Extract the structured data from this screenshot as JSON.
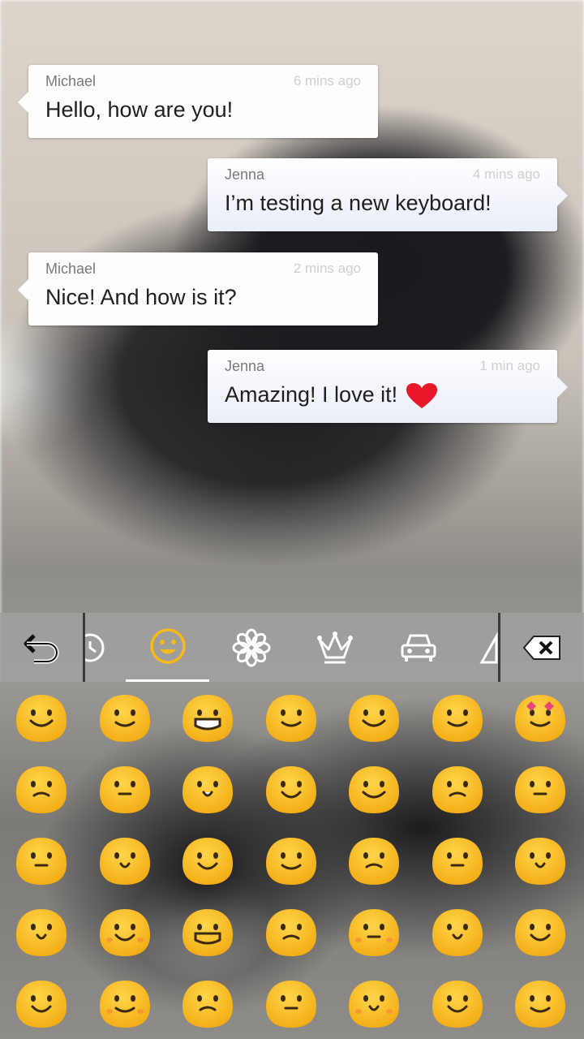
{
  "messages": [
    {
      "sender": "Michael",
      "time": "6 mins ago",
      "text": "Hello, how are you!"
    },
    {
      "sender": "Jenna",
      "time": "4 mins ago",
      "text": "I’m testing a new keyboard!"
    },
    {
      "sender": "Michael",
      "time": "2 mins ago",
      "text": "Nice! And how is it?"
    },
    {
      "sender": "Jenna",
      "time": "1 min ago",
      "text": "Amazing! I love it!"
    }
  ],
  "keyboard": {
    "tabs": [
      {
        "icon": "undo-icon"
      },
      {
        "icon": "recent-clock-icon"
      },
      {
        "icon": "smiley-icon",
        "active": true
      },
      {
        "icon": "flower-icon"
      },
      {
        "icon": "crown-icon"
      },
      {
        "icon": "car-icon"
      },
      {
        "icon": "triangle-icon"
      },
      {
        "icon": "backspace-icon"
      }
    ],
    "emoji_rows": 5,
    "emoji_cols": 7
  },
  "colors": {
    "emoji_yellow": "#f6b91b",
    "emoji_outline": "#e09a10",
    "active_tab_icon": "#f6b91b",
    "heart": "#e8182a"
  }
}
